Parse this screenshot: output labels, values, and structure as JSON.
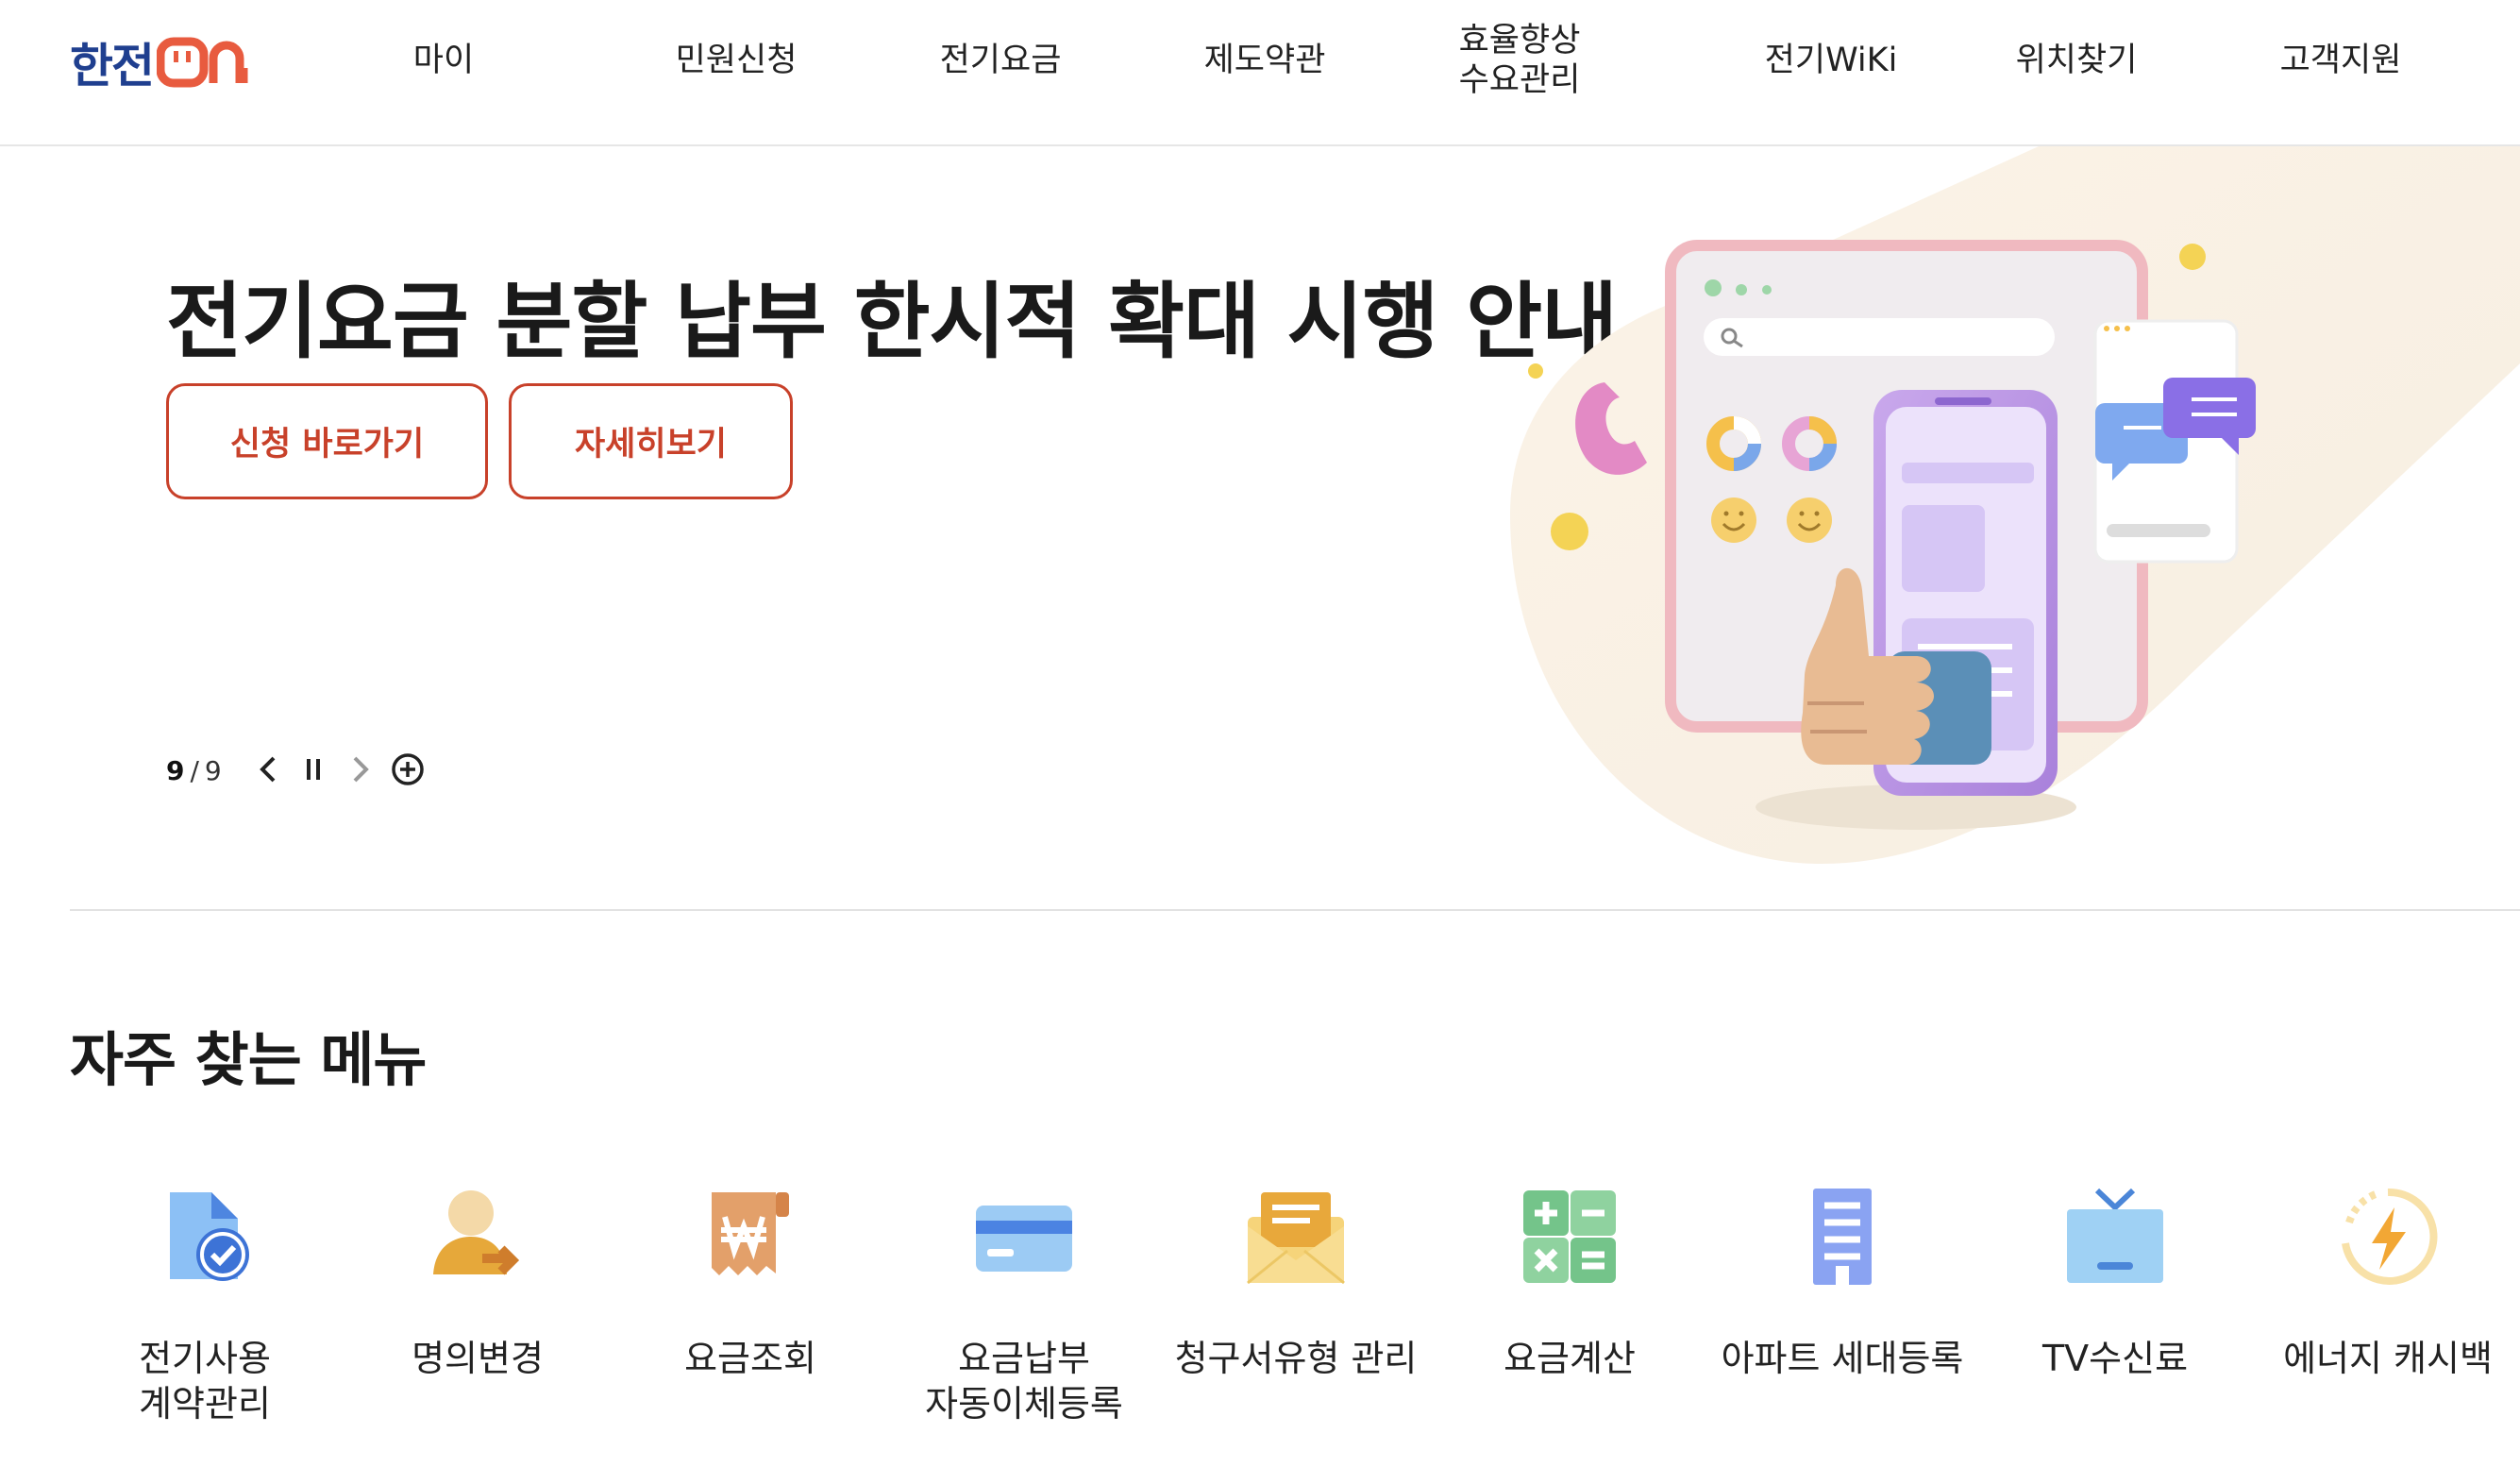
{
  "header": {
    "logo": {
      "text": "한전",
      "suffix": "ON",
      "icon": "plug-icon"
    },
    "nav": [
      "마이",
      "민원신청",
      "전기요금",
      "제도약관",
      "효율향상\n수요관리",
      "전기WiKi",
      "위치찾기",
      "고객지원"
    ]
  },
  "hero": {
    "title": "전기요금 분할 납부 한시적 확대 시행 안내",
    "buttons": {
      "apply": "신청 바로가기",
      "details": "자세히보기"
    },
    "slide": {
      "current": "9",
      "separator": "/",
      "total": "9"
    },
    "controls": [
      "chevron-left-icon",
      "pause-icon",
      "chevron-right-icon",
      "plus-circle-icon"
    ],
    "illustration": "app-thumbs-up-illustration"
  },
  "frequent": {
    "title": "자주 찾는 메뉴",
    "items": [
      {
        "label": "전기사용\n계약관리",
        "icon": "document-check-icon"
      },
      {
        "label": "명의변경",
        "icon": "person-transfer-icon"
      },
      {
        "label": "요금조회",
        "icon": "won-receipt-icon"
      },
      {
        "label": "요금납부\n자동이체등록",
        "icon": "credit-card-icon"
      },
      {
        "label": "청구서유형 관리",
        "icon": "envelope-icon"
      },
      {
        "label": "요금계산",
        "icon": "calculator-icon"
      },
      {
        "label": "아파트 세대등록",
        "icon": "building-icon"
      },
      {
        "label": "TV수신료",
        "icon": "tv-icon"
      },
      {
        "label": "에너지 캐시백",
        "icon": "energy-cashback-icon"
      }
    ]
  },
  "colors": {
    "brand_blue": "#1f3f8f",
    "brand_red": "#c8412a",
    "divider": "#e2e2e2"
  }
}
